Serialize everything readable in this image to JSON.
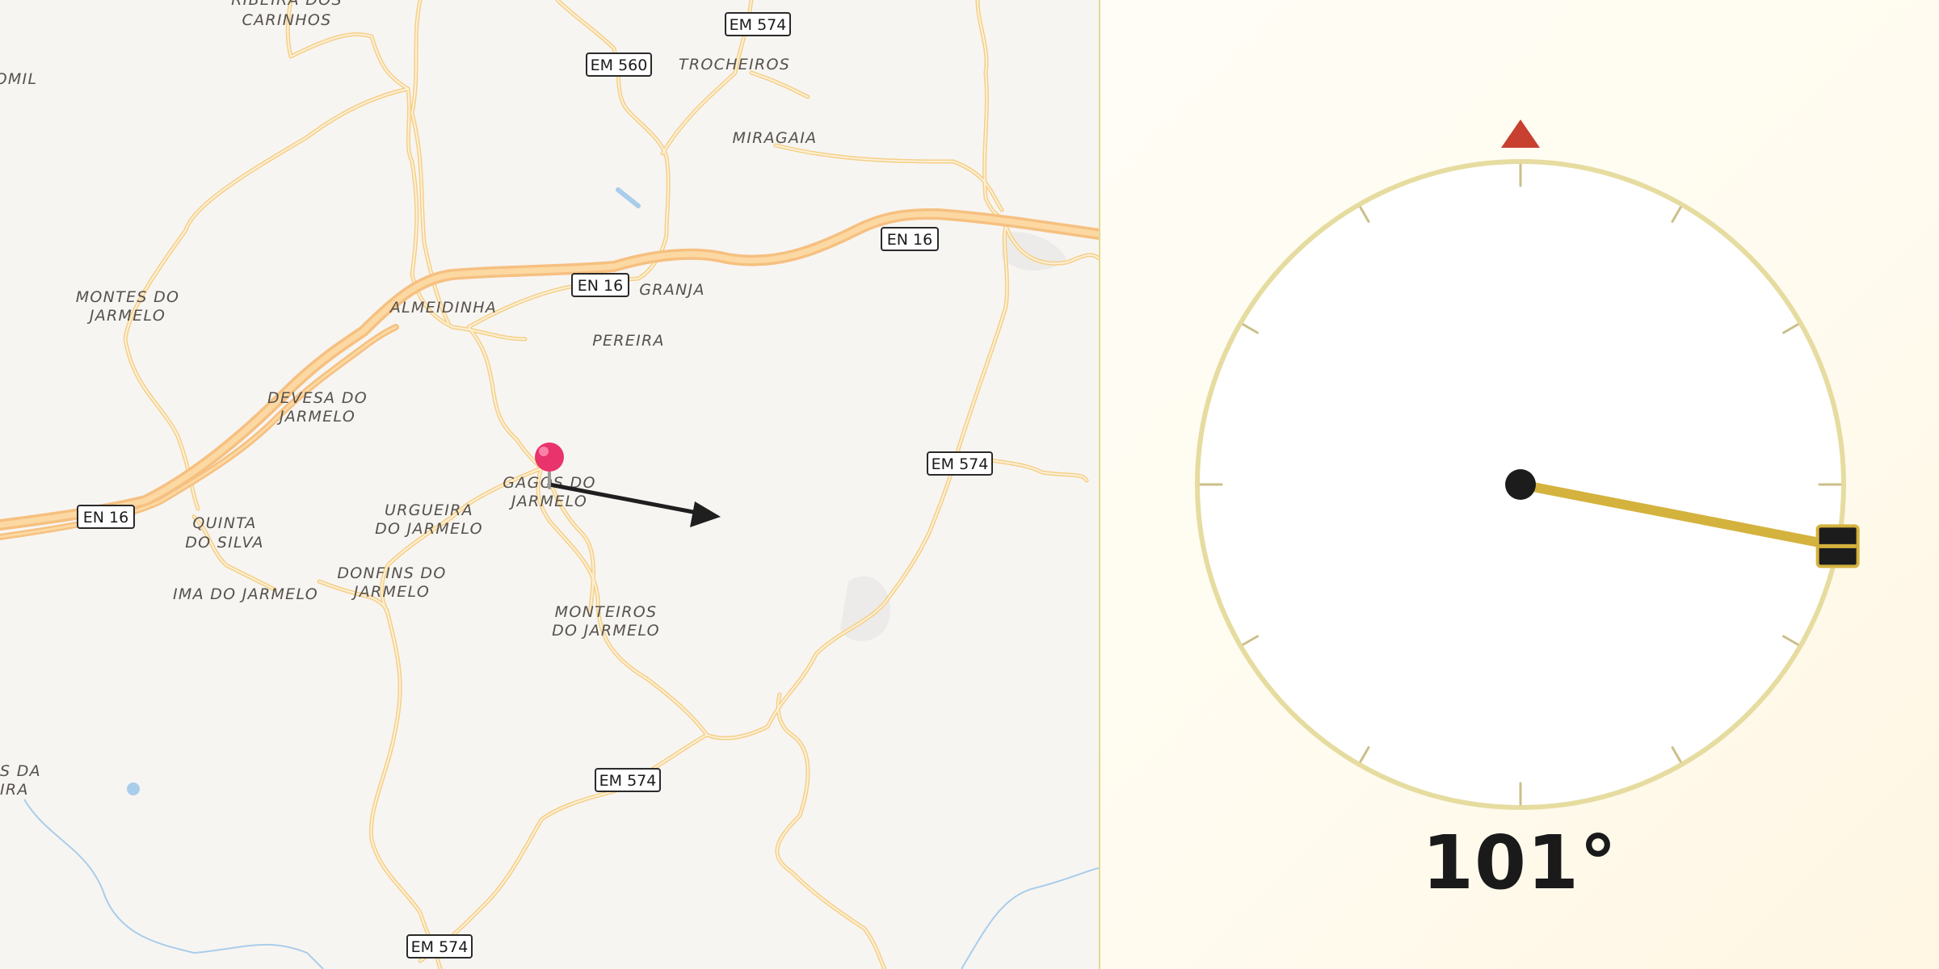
{
  "map": {
    "places": [
      {
        "name": "ribeira-dos-carinhos",
        "lines": [
          "RIBEIRA DOS",
          "CARINHOS"
        ]
      },
      {
        "name": "domil",
        "lines": [
          "DOMIL"
        ]
      },
      {
        "name": "trocheiros",
        "lines": [
          "TROCHEIROS"
        ]
      },
      {
        "name": "miragaia",
        "lines": [
          "MIRAGAIA"
        ]
      },
      {
        "name": "montes-do-jarmelo",
        "lines": [
          "MONTES DO",
          "JARMELO"
        ]
      },
      {
        "name": "almeidinha",
        "lines": [
          "ALMEIDINHA"
        ]
      },
      {
        "name": "granja",
        "lines": [
          "GRANJA"
        ]
      },
      {
        "name": "pereira",
        "lines": [
          "PEREIRA"
        ]
      },
      {
        "name": "devesa-do-jarmelo",
        "lines": [
          "DEVESA DO",
          "JARMELO"
        ]
      },
      {
        "name": "gagos-do-jarmelo",
        "lines": [
          "GAGOS DO",
          "JARMELO"
        ]
      },
      {
        "name": "urgueira-do-jarmelo",
        "lines": [
          "URGUEIRA",
          "DO JARMELO"
        ]
      },
      {
        "name": "quinta-do-silva",
        "lines": [
          "QUINTA",
          "DO SILVA"
        ]
      },
      {
        "name": "donfins-do-jarmelo",
        "lines": [
          "DONFINS DO",
          "JARMELO"
        ]
      },
      {
        "name": "ima-do-jarmelo",
        "lines": [
          "IMA DO JARMELO"
        ]
      },
      {
        "name": "monteiros-do-jarmelo",
        "lines": [
          "MONTEIROS",
          "DO JARMELO"
        ]
      },
      {
        "name": "partial-place-southwest",
        "lines": [
          "S DA",
          "IRA"
        ]
      }
    ],
    "shields": [
      {
        "name": "shield-em574-north",
        "label": "EM 574"
      },
      {
        "name": "shield-em560",
        "label": "EM 560"
      },
      {
        "name": "shield-en16-east",
        "label": "EN 16"
      },
      {
        "name": "shield-en16-center",
        "label": "EN 16"
      },
      {
        "name": "shield-em574-east",
        "label": "EM 574"
      },
      {
        "name": "shield-en16-west",
        "label": "EN 16"
      },
      {
        "name": "shield-em574-south",
        "label": "EM 574"
      },
      {
        "name": "shield-em574-bottom",
        "label": "EM 574"
      }
    ],
    "pin_color": "#e8336d",
    "arrow_color": "#1f1f1f"
  },
  "compass": {
    "heading_deg": 101,
    "heading_text": "101°",
    "north_marker_color": "#c8402f",
    "ring_color": "#e6dca0",
    "needle_color": "#d4b23e"
  }
}
